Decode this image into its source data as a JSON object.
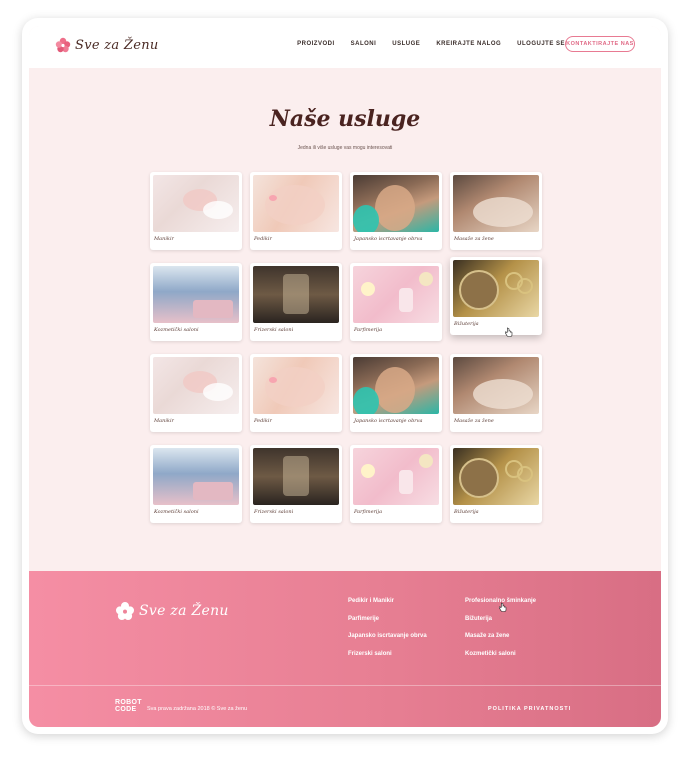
{
  "brand": {
    "name": "Sve za Ženu",
    "accent": "#e87a92",
    "dark": "#4a2320"
  },
  "nav": {
    "items": [
      "PROIZVODI",
      "SALONI",
      "USLUGE",
      "KREIRAJTE NALOG",
      "ULOGUJTE SE"
    ],
    "contact": "KONTAKTIRAJTE NAS"
  },
  "main": {
    "title": "Naše usluge",
    "subtitle": "Jedna ili više usluge vas mogu interesovati",
    "cards": [
      {
        "label": "Manikir",
        "image": "manikir"
      },
      {
        "label": "Pedikir",
        "image": "pedikir"
      },
      {
        "label": "Japansko iscrtavanje obrva",
        "image": "japan"
      },
      {
        "label": "Masaže za žene",
        "image": "masaza"
      },
      {
        "label": "Kozmetički saloni",
        "image": "kozmet"
      },
      {
        "label": "Frizerski saloni",
        "image": "frizer"
      },
      {
        "label": "Parfimerija",
        "image": "parf"
      },
      {
        "label": "Bižuterija",
        "image": "bizu"
      },
      {
        "label": "Manikir",
        "image": "manikir"
      },
      {
        "label": "Pedikir",
        "image": "pedikir"
      },
      {
        "label": "Japansko iscrtavanje obrva",
        "image": "japan"
      },
      {
        "label": "Masaže za žene",
        "image": "masaza"
      },
      {
        "label": "Kozmetički saloni",
        "image": "kozmet"
      },
      {
        "label": "Frizerski saloni",
        "image": "frizer"
      },
      {
        "label": "Parfimerija",
        "image": "parf"
      },
      {
        "label": "Bižuterija",
        "image": "bizu"
      }
    ]
  },
  "footer": {
    "col1": [
      "Pedikir i Manikir",
      "Parfimerije",
      "Japansko iscrtavanje obrva",
      "Frizerski saloni"
    ],
    "col2": [
      "Profesionalno šminkanje",
      "Bižuterija",
      "Masaže za žene",
      "Kozmetički saloni"
    ],
    "robot_logo": [
      "ROBOT",
      "CODE"
    ],
    "copyright": "Sva prava zadržana 2018 © Sve za ženu",
    "privacy": "POLITIKA PRIVATNOSTI"
  }
}
